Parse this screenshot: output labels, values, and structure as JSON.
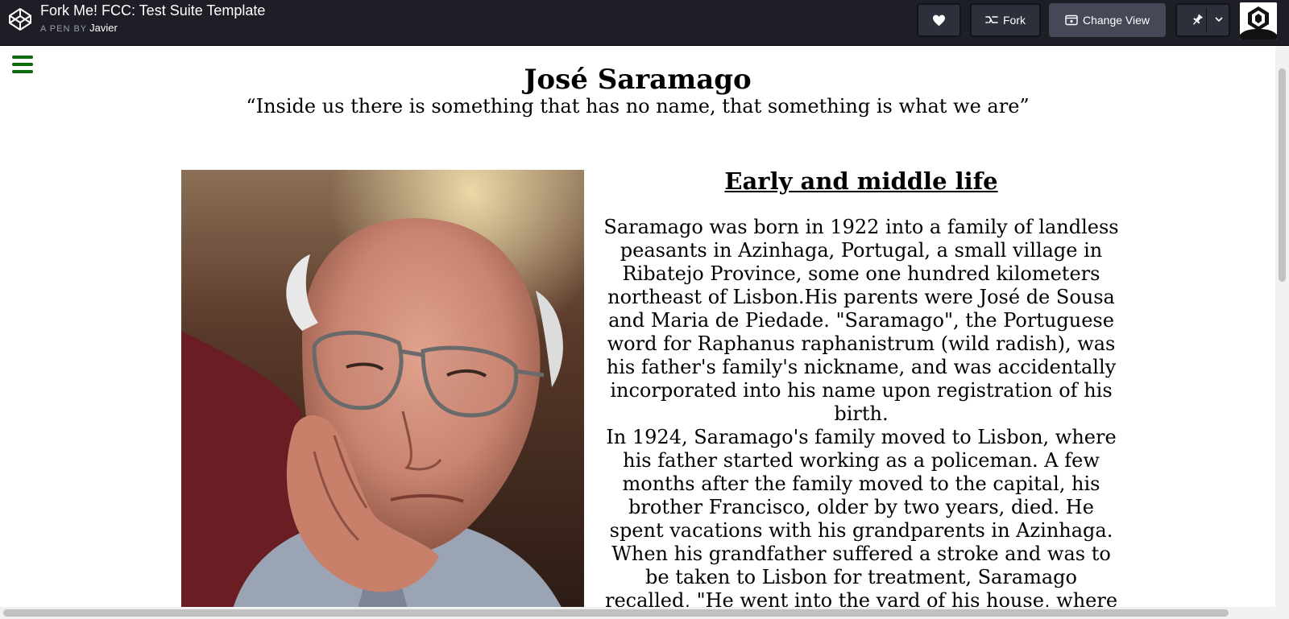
{
  "header": {
    "pen_title": "Fork Me! FCC: Test Suite Template",
    "pen_by_label": "A PEN BY",
    "author": "Javier",
    "fork_label": "Fork",
    "change_view_label": "Change View",
    "icons": {
      "logo": "codepen-logo-icon",
      "heart": "heart-icon",
      "fork": "fork-icon",
      "view": "change-view-icon",
      "pin": "pin-icon",
      "dropdown": "chevron-down-icon",
      "avatar": "user-avatar"
    }
  },
  "page": {
    "menu_icon": "hamburger-menu-icon",
    "name": "José Saramago",
    "quote": "“Inside us there is something that has no name, that something is what we are”",
    "portrait_alt": "Portrait of José Saramago",
    "section_title": "Early and middle life",
    "paragraphs": [
      "Saramago was born in 1922 into a family of landless peasants in Azinhaga, Portugal, a small village in Ribatejo Province, some one hundred kilometers northeast of Lisbon.His parents were José de Sousa and Maria de Piedade. \"Saramago\", the Portuguese word for Raphanus raphanistrum (wild radish), was his father's family's nickname, and was accidentally incorporated into his name upon registration of his birth.",
      "In 1924, Saramago's family moved to Lisbon, where his father started working as a policeman. A few months after the family moved to the capital, his brother Francisco, older by two years, died. He spent vacations with his grandparents in Azinhaga. When his grandfather suffered a stroke and was to be taken to Lisbon for treatment, Saramago recalled, \"He went into the yard of his house, where"
    ]
  },
  "colors": {
    "topbar": "#1e1f26",
    "button": "#2c303a",
    "button_active": "#444857",
    "menu_icon": "#0b6b0b"
  }
}
